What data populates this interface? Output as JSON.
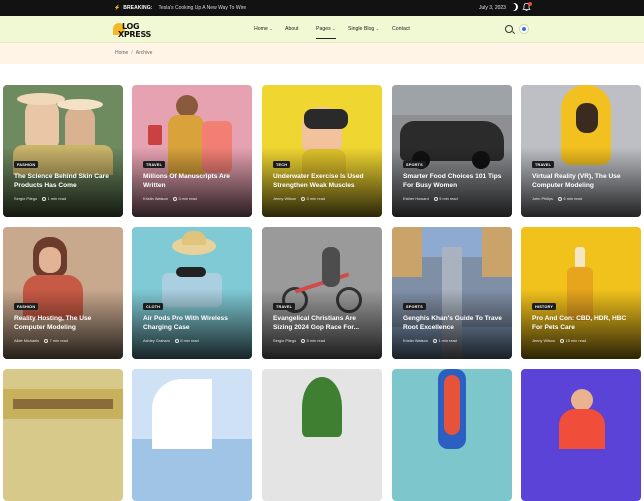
{
  "topbar": {
    "breaking_label": "BREAKING:",
    "breaking_text": "Tesla's Cooking Up A New Way To Wire",
    "date": "July 3, 2023"
  },
  "header": {
    "logo_line1": "LOG",
    "logo_line2": "XPRESS",
    "nav": [
      {
        "label": "Home",
        "dropdown": true
      },
      {
        "label": "About",
        "dropdown": false
      },
      {
        "label": "Pages",
        "dropdown": true,
        "active": true
      },
      {
        "label": "Single Blog",
        "dropdown": true
      },
      {
        "label": "Contact",
        "dropdown": false
      }
    ]
  },
  "breadcrumb": {
    "home": "Home",
    "separator": "/",
    "current": "Archive"
  },
  "posts": [
    {
      "category": "FASHION",
      "title": "The Science Behind Skin Care Products Has Come",
      "author": "Sergio Pliego",
      "read": "1 min read",
      "bg": "#6e8a5f"
    },
    {
      "category": "TRAVEL",
      "title": "Millions Of Manuscripts Are Written",
      "author": "Kristin Watson",
      "read": "3 min read",
      "bg": "#e7a2b2"
    },
    {
      "category": "TECH",
      "title": "Underwater Exercise Is Used Strengthen Weak Muscles",
      "author": "Jenny Wilson",
      "read": "5 min read",
      "bg": "#f0d631"
    },
    {
      "category": "SPORTS",
      "title": "Smarter Food Choices 101 Tips For Busy Women",
      "author": "Esther Howard",
      "read": "9 min read",
      "bg": "#8d8f92"
    },
    {
      "category": "TRAVEL",
      "title": "Virtual Reality (VR), The Use Computer Modeling",
      "author": "John Philips",
      "read": "6 min read",
      "bg": "#bdbfc4"
    },
    {
      "category": "FASHION",
      "title": "Reality Hosting, The Use Computer Modeling",
      "author": "Albie Michaels",
      "read": "7 min read",
      "bg": "#c9a98e"
    },
    {
      "category": "CLOTH",
      "title": "Air Pods Pro With Wireless Charging Case",
      "author": "Ashley Graham",
      "read": "8 min read",
      "bg": "#7fcad5"
    },
    {
      "category": "TRAVEL",
      "title": "Evangelical Christians Are Sizing 2024 Gop Race For...",
      "author": "Sergio Pliego",
      "read": "5 min read",
      "bg": "#9a9a9a"
    },
    {
      "category": "SPORTS",
      "title": "Genghis Khan's Guide To Trave Root Excellence",
      "author": "Kristin Watson",
      "read": "1 min read",
      "bg": "#8eaad0"
    },
    {
      "category": "HISTORY",
      "title": "Pro And Con: CBD, HDR, HBC For Pets Care",
      "author": "Jenny Wilson",
      "read": "15 min read",
      "bg": "#f2c21c"
    },
    {
      "category": "",
      "title": "",
      "author": "",
      "read": "",
      "bg": "#d6c98a"
    },
    {
      "category": "",
      "title": "",
      "author": "",
      "read": "",
      "bg": "#9fc4e6"
    },
    {
      "category": "",
      "title": "",
      "author": "",
      "read": "",
      "bg": "#e4e4e4"
    },
    {
      "category": "",
      "title": "",
      "author": "",
      "read": "",
      "bg": "#7dc7cc"
    },
    {
      "category": "",
      "title": "",
      "author": "",
      "read": "",
      "bg": "#5a43d6"
    }
  ]
}
